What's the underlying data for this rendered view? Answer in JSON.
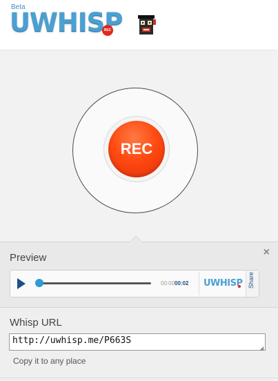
{
  "header": {
    "beta_label": "Beta",
    "logo_text": "UWHISP",
    "logo_badge": "REC"
  },
  "recorder": {
    "rec_label": "REC"
  },
  "preview": {
    "title": "Preview",
    "close_symbol": "×",
    "player": {
      "time_elapsed": "00:00",
      "time_total": "00:02",
      "progress": 0,
      "brand": "UWHISP",
      "share_label": "Share"
    }
  },
  "whisp_url": {
    "title": "Whisp URL",
    "value": "http://uwhisp.me/P663S",
    "hint": "Copy it to any place"
  },
  "colors": {
    "accent_blue": "#4aa0d3",
    "rec_red": "#ff4a12",
    "navy": "#1c4f8a"
  },
  "icons": [
    "play-icon",
    "close-icon",
    "mascot-icon"
  ]
}
